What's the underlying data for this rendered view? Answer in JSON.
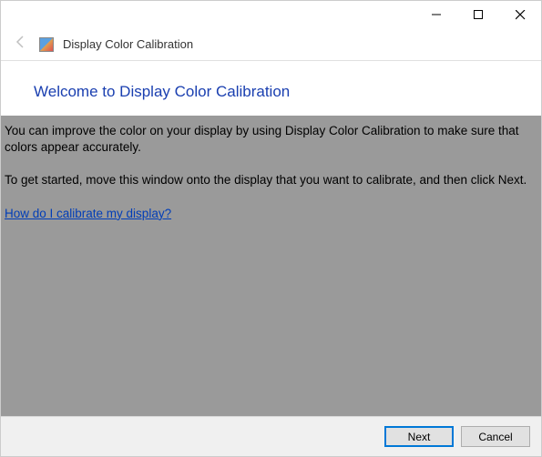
{
  "window": {
    "title": "Display Color Calibration"
  },
  "page": {
    "heading": "Welcome to Display Color Calibration",
    "paragraph1": "You can improve the color on your display by using Display Color Calibration to make sure that colors appear accurately.",
    "paragraph2": "To get started, move this window onto the display that you want to calibrate, and then click Next.",
    "help_link": "How do I calibrate my display?"
  },
  "buttons": {
    "next": "Next",
    "cancel": "Cancel"
  }
}
